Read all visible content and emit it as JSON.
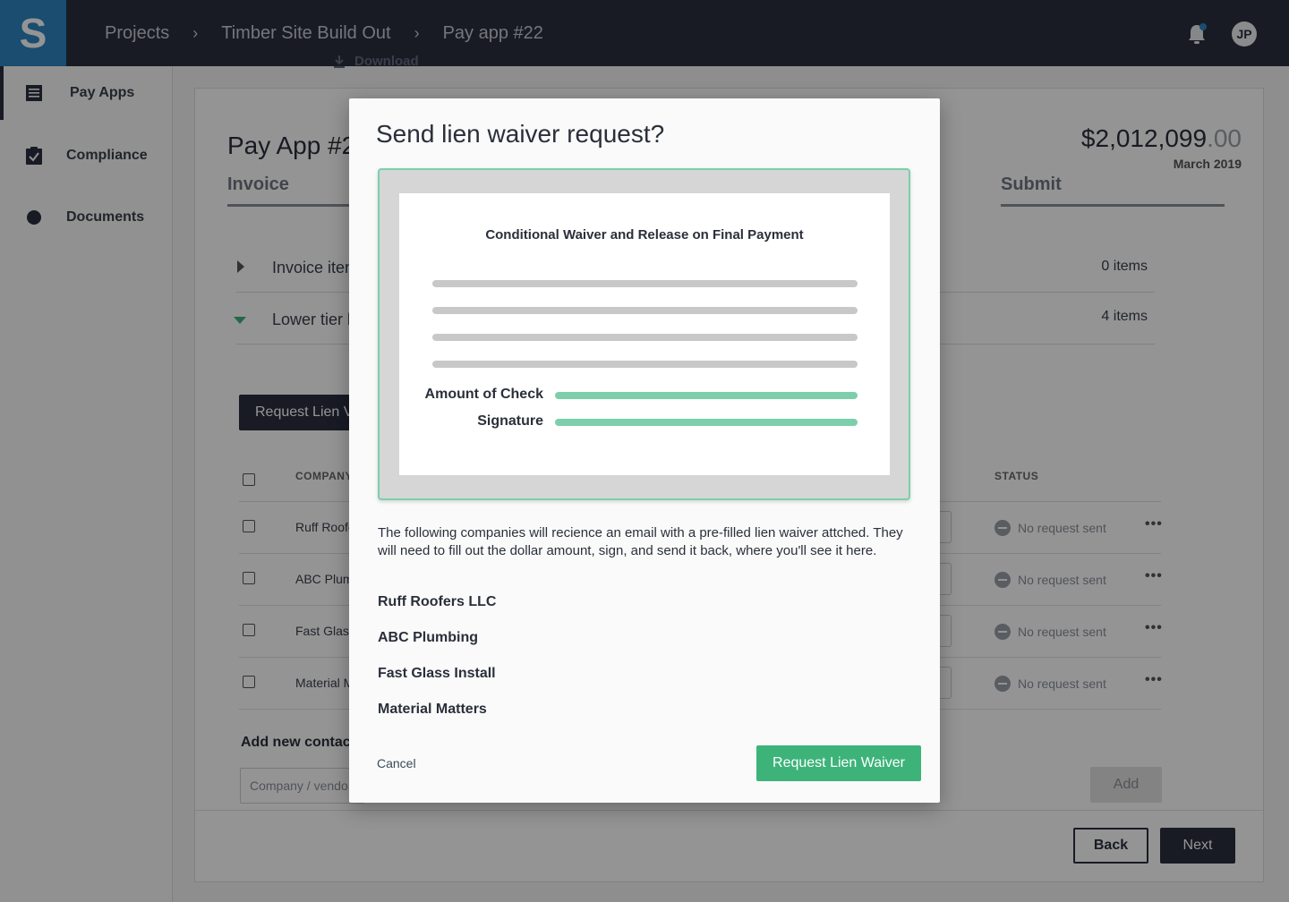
{
  "app": {
    "logo_letter": "S",
    "breadcrumb": [
      "Projects",
      "Timber Site Build Out",
      "Pay app #22"
    ],
    "breadcrumb_separator": "›",
    "avatar_initials": "JP",
    "download_label": "Download",
    "accent_color": "#2e86c1",
    "notification_dot_color": "#2e86c1"
  },
  "sidebar": {
    "items": [
      {
        "label": "Pay Apps",
        "icon": "list-icon",
        "active": true
      },
      {
        "label": "Compliance",
        "icon": "clipboard-check-icon",
        "active": false
      },
      {
        "label": "Documents",
        "icon": "circle-icon",
        "active": false
      }
    ]
  },
  "background": {
    "title": "Pay App #2",
    "amount_main": "$2,012,099",
    "amount_cents": ".00",
    "date": "March 2019",
    "step_invoice": "Invoice",
    "step_submit": "Submit",
    "rows": [
      {
        "label": "Invoice iten",
        "count": "0 items"
      },
      {
        "label": "Lower tier l",
        "count": "4 items"
      }
    ],
    "request_button": "Request Lien V",
    "table_header_company": "COMPANY",
    "table_header_status": "STATUS",
    "table_rows": [
      {
        "company": "Ruff Roofe",
        "status": "No request sent"
      },
      {
        "company": "ABC Plum",
        "status": "No request sent"
      },
      {
        "company": "Fast Glass",
        "status": "No request sent"
      },
      {
        "company": "Material M",
        "status": "No request sent"
      }
    ],
    "more_label": "•••",
    "add_contact_label": "Add new contact",
    "input_placeholder": "Company / vendo",
    "add_button": "Add",
    "back_button": "Back",
    "next_button": "Next"
  },
  "modal": {
    "title": "Send lien waiver request?",
    "document_title": "Conditional Waiver and Release on Final Payment",
    "field_amount": "Amount of Check",
    "field_signature": "Signature",
    "description": "The following companies will recience an email with a pre-filled lien waiver attched. They will need to fill out the dollar amount, sign, and send it back, where you'll see it here.",
    "companies": [
      "Ruff Roofers LLC",
      "ABC Plumbing",
      "Fast Glass Install",
      "Material Matters"
    ],
    "cancel_label": "Cancel",
    "confirm_label": "Request Lien Waiver",
    "confirm_color": "#3db37a",
    "highlight_color": "#7ccfaa"
  }
}
